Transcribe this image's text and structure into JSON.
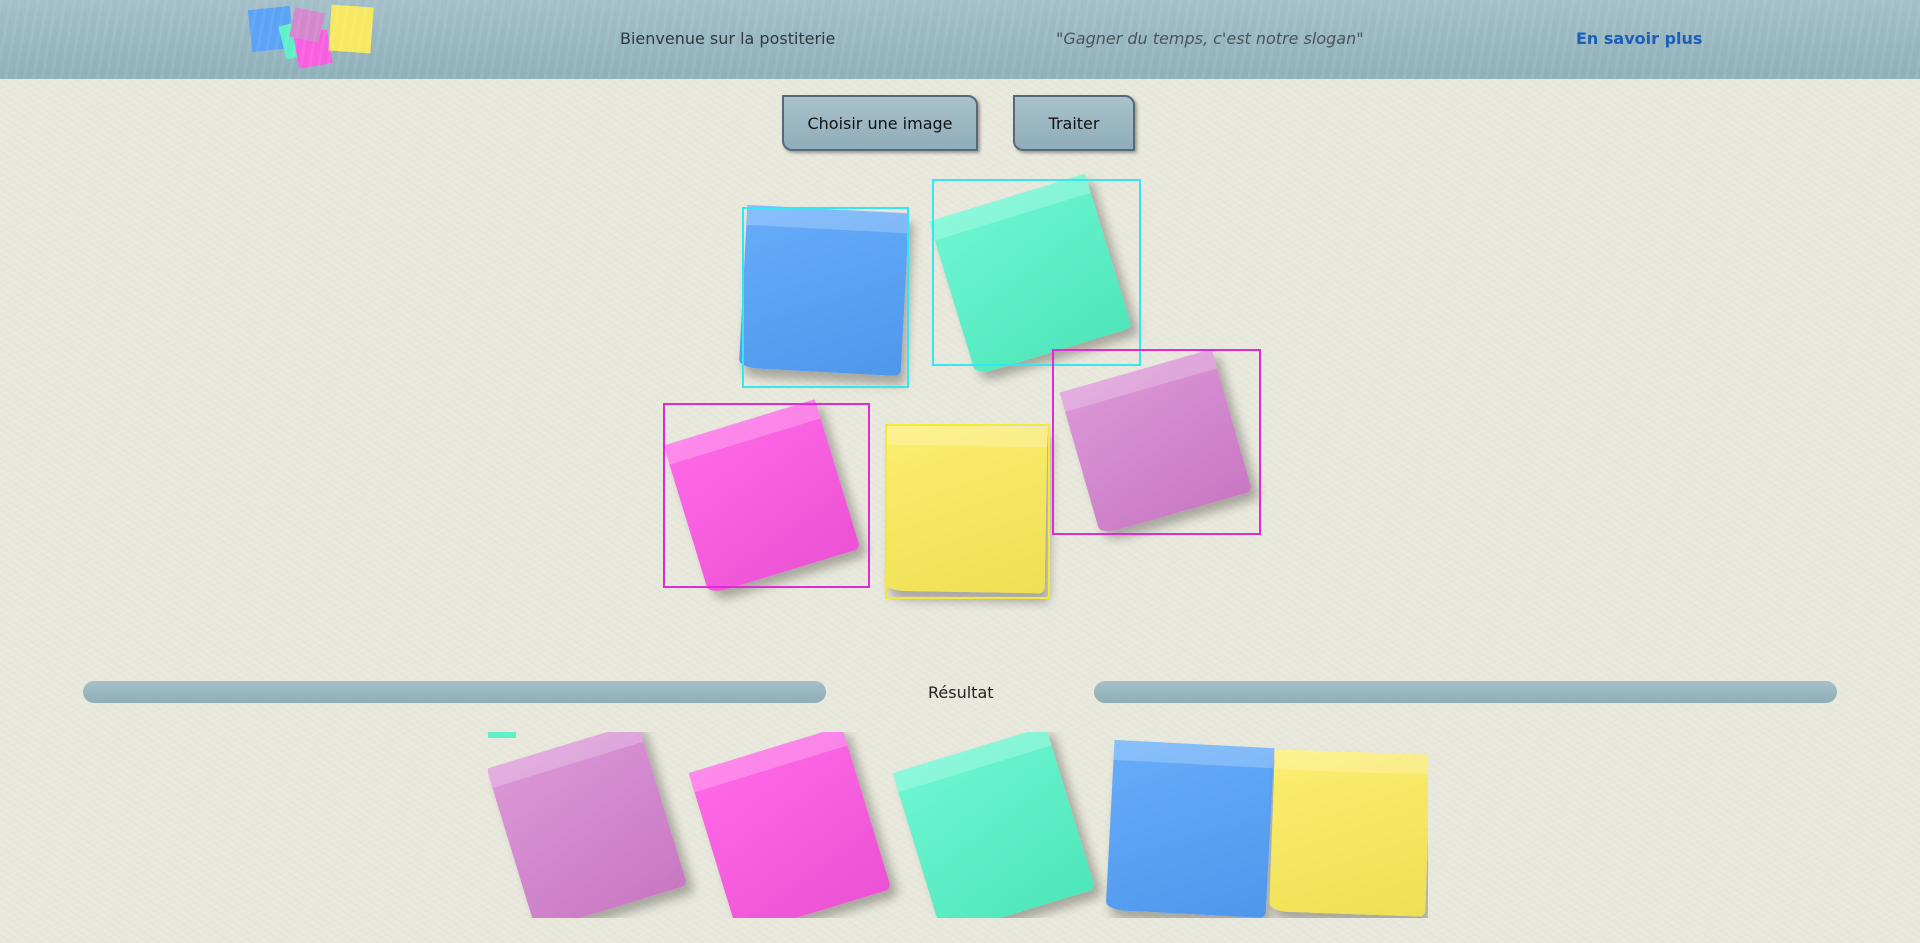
{
  "header": {
    "logo": "sticky-notes-logo",
    "welcome": "Bienvenue sur la postiterie",
    "slogan": "\"Gagner du temps, c'est notre slogan\"",
    "learn_more": "En savoir plus"
  },
  "toolbar": {
    "choose_image": "Choisir une image",
    "process": "Traiter"
  },
  "detection": {
    "notes": [
      {
        "color": "#5aa3f6",
        "box_color": "#33e6f0"
      },
      {
        "color": "#5ff0c8",
        "box_color": "#33e6f0"
      },
      {
        "color": "#f75ee0",
        "box_color": "#e02ad8"
      },
      {
        "color": "#f7e862",
        "box_color": "#f4e83a"
      },
      {
        "color": "#d489cf",
        "box_color": "#e02ad8"
      }
    ]
  },
  "result": {
    "label": "Résultat",
    "notes": [
      "violet",
      "pink",
      "green",
      "blue",
      "yellow"
    ]
  },
  "colors": {
    "header": "#97b5be",
    "background": "#e9e9dd",
    "link": "#1b5fb8"
  }
}
